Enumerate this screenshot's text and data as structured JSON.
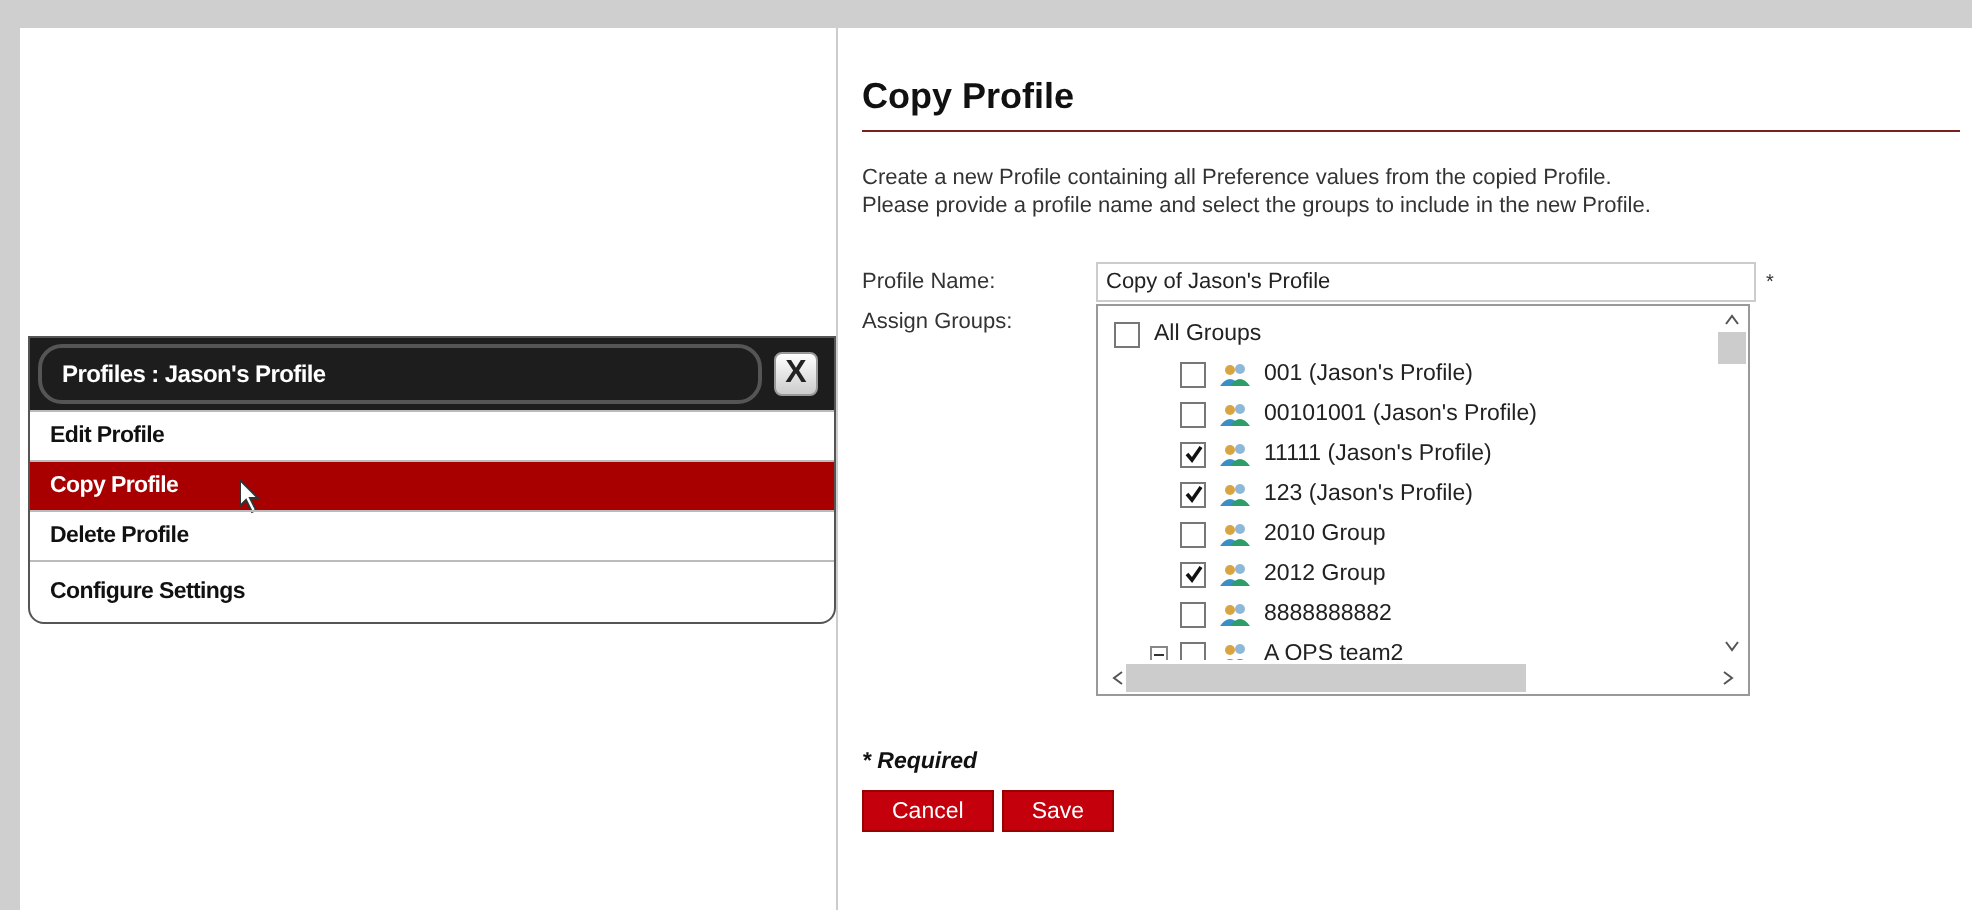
{
  "menu": {
    "title": "Profiles : Jason's Profile",
    "close": "X",
    "items": [
      {
        "label": "Edit Profile",
        "selected": false
      },
      {
        "label": "Copy Profile",
        "selected": true
      },
      {
        "label": "Delete Profile",
        "selected": false
      },
      {
        "label": "Configure Settings",
        "selected": false
      }
    ]
  },
  "dialog": {
    "title": "Copy Profile",
    "description": [
      "Create a new Profile containing all Preference values from the copied Profile.",
      "Please provide a profile name and select the groups to include in the new Profile."
    ],
    "profile_name": {
      "label": "Profile Name:",
      "value": "Copy of Jason's Profile",
      "required_mark": "*"
    },
    "assign_groups": {
      "label": "Assign Groups:",
      "tree": [
        {
          "label": "All Groups",
          "checked": false,
          "children": [
            {
              "label": "001 (Jason's Profile)",
              "checked": false
            },
            {
              "label": "00101001 (Jason's Profile)",
              "checked": false
            },
            {
              "label": "11111 (Jason's Profile)",
              "checked": true
            },
            {
              "label": "123 (Jason's Profile)",
              "checked": true
            },
            {
              "label": "2010 Group",
              "checked": false
            },
            {
              "label": "2012 Group",
              "checked": true
            },
            {
              "label": "8888888882",
              "checked": false
            },
            {
              "label": "A OPS team2",
              "checked": false,
              "expanded": true
            }
          ]
        }
      ]
    },
    "required_note": "* Required",
    "buttons": [
      "Cancel",
      "Save"
    ]
  }
}
